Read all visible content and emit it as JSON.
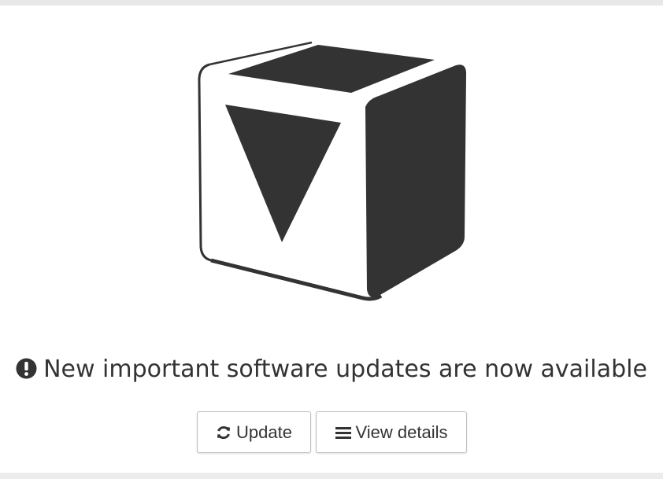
{
  "message": {
    "text": "New important software updates are now available",
    "icon": "exclamation-circle-icon"
  },
  "logo": {
    "icon": "package-box-icon",
    "color": "#333333"
  },
  "buttons": {
    "update_label": "Update",
    "update_icon": "refresh-icon",
    "details_label": "View details",
    "details_icon": "list-icon"
  }
}
